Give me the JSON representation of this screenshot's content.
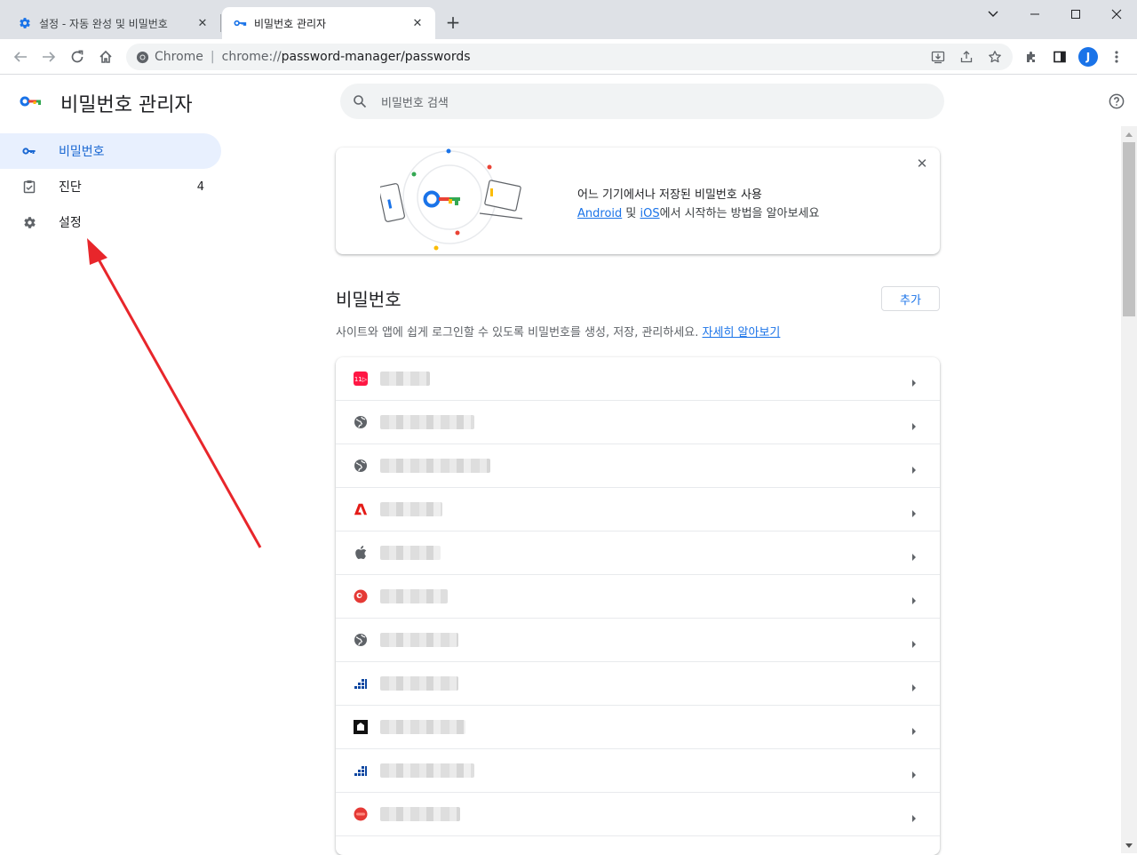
{
  "tabs": [
    {
      "title": "설정 - 자동 완성 및 비밀번호",
      "icon": "gear-icon",
      "active": false
    },
    {
      "title": "비밀번호 관리자",
      "icon": "key-icon",
      "active": true
    }
  ],
  "toolbar": {
    "omnibox_label": "Chrome",
    "url_scheme": "chrome://",
    "url_rest": "password-manager/passwords",
    "profile_initial": "J"
  },
  "app": {
    "title": "비밀번호 관리자",
    "search_placeholder": "비밀번호 검색"
  },
  "nav": [
    {
      "label": "비밀번호",
      "icon": "key-icon",
      "selected": true
    },
    {
      "label": "진단",
      "icon": "checkup-icon",
      "count": "4"
    },
    {
      "label": "설정",
      "icon": "gear-icon"
    }
  ],
  "promo": {
    "title": "어느 기기에서나 저장된 비밀번호 사용",
    "link_android": "Android",
    "and": " 및 ",
    "link_ios": "iOS",
    "rest": "에서 시작하는 방법을 알아보세요"
  },
  "passwords_section": {
    "title": "비밀번호",
    "add_label": "추가",
    "desc": "사이트와 앱에 쉽게 로그인할 수 있도록 비밀번호를 생성, 저장, 관리하세요. ",
    "learn_more": "자세히 알아보기"
  },
  "password_rows": [
    {
      "icon": "11st-icon",
      "label": "▒▒▒▒▒▒"
    },
    {
      "icon": "globe-icon",
      "label": "▒▒▒▒▒▒▒▒▒▒"
    },
    {
      "icon": "globe-icon",
      "label": "▒▒▒▒▒▒▒▒▒▒▒▒"
    },
    {
      "icon": "adobe-icon",
      "label": "▒▒▒▒▒▒▒"
    },
    {
      "icon": "apple-icon",
      "label": "▒▒▒▒▒▒"
    },
    {
      "icon": "red-circle-icon",
      "label": "▒▒▒▒▒▒▒"
    },
    {
      "icon": "globe-icon",
      "label": "▒▒▒▒▒▒▒▒"
    },
    {
      "icon": "bars-icon",
      "label": "▒▒▒▒▒▒▒▒"
    },
    {
      "icon": "square-logo-icon",
      "label": "▒▒▒▒▒▒▒▒▒"
    },
    {
      "icon": "bars-icon",
      "label": "▒▒▒▒▒▒▒▒▒▒"
    },
    {
      "icon": "red-badge-icon",
      "label": "▒▒▒▒▒▒▒▒"
    }
  ],
  "colors": {
    "accent": "#1a73e8",
    "nav_selected_bg": "#e8f0fe",
    "annotation_arrow": "#e8262b"
  }
}
